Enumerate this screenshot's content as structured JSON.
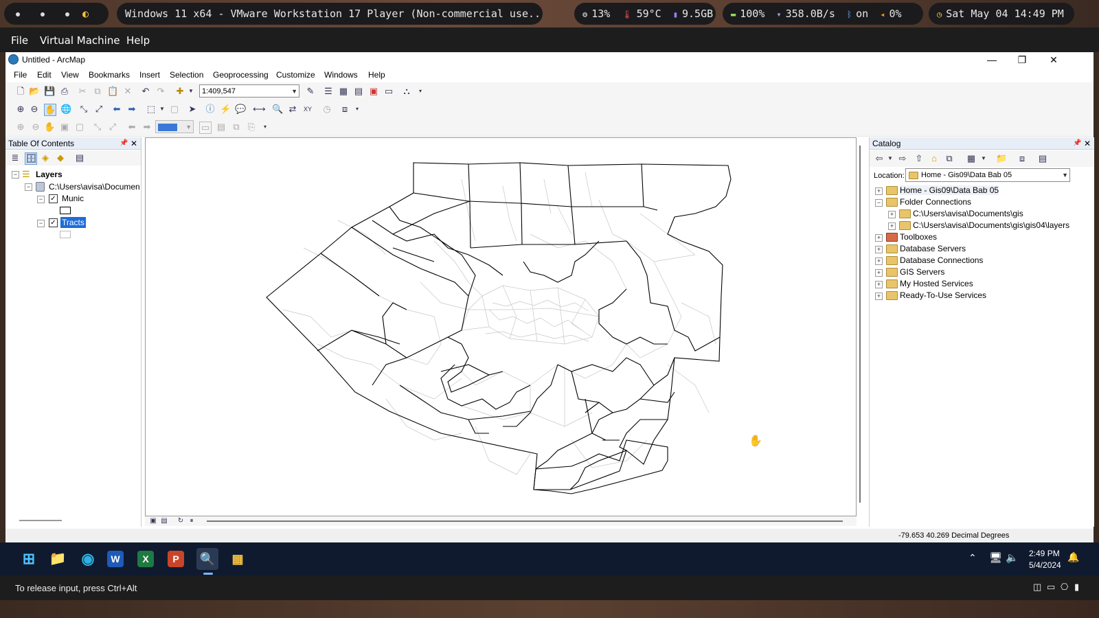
{
  "topbar": {
    "window_title": "Windows 11 x64 - VMware Workstation 17 Player (Non-commercial use...",
    "cpu": "13%",
    "temp": "59°C",
    "mem": "9.5GB",
    "battery": "100%",
    "net": "358.0B/s",
    "bluetooth": "on",
    "volume": "0%",
    "datetime": "Sat May 04 14:49 PM"
  },
  "vmmenu": {
    "file": "File",
    "vm": "Virtual Machine",
    "help": "Help"
  },
  "app": {
    "title": "Untitled - ArcMap",
    "menu": [
      "File",
      "Edit",
      "View",
      "Bookmarks",
      "Insert",
      "Selection",
      "Geoprocessing",
      "Customize",
      "Windows",
      "Help"
    ],
    "scale": "1:409,547"
  },
  "toc": {
    "title": "Table Of Contents",
    "root": "Layers",
    "source": "C:\\Users\\avisa\\Documen",
    "layers": [
      "Munic",
      "Tracts"
    ]
  },
  "catalog": {
    "title": "Catalog",
    "location_label": "Location:",
    "location_value": "Home - Gis09\\Data Bab 05",
    "items": [
      "Home - Gis09\\Data Bab 05",
      "Folder Connections",
      "C:\\Users\\avisa\\Documents\\gis",
      "C:\\Users\\avisa\\Documents\\gis\\gis04\\layers",
      "Toolboxes",
      "Database Servers",
      "Database Connections",
      "GIS Servers",
      "My Hosted Services",
      "Ready-To-Use Services"
    ]
  },
  "status": {
    "coords": "-79.653  40.269 Decimal Degrees"
  },
  "taskbar": {
    "time": "2:49 PM",
    "date": "5/4/2024"
  },
  "vmstatus": {
    "hint": "To release input, press Ctrl+Alt"
  }
}
